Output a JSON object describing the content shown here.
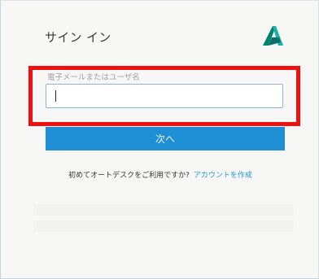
{
  "header": {
    "title": "サイン イン",
    "logo_icon": "autodesk-logo-icon",
    "logo_color": "#0aa6a0"
  },
  "form": {
    "username_label": "電子メールまたはユーザ名",
    "username_value": "",
    "next_button_label": "次へ",
    "next_button_color": "#1f8fd5"
  },
  "signup": {
    "prompt": "初めてオートデスクをご利用ですか?",
    "link_label": "アカウントを作成",
    "link_color": "#1f9bd6"
  },
  "annotation": {
    "highlight_color": "#ee1111"
  }
}
